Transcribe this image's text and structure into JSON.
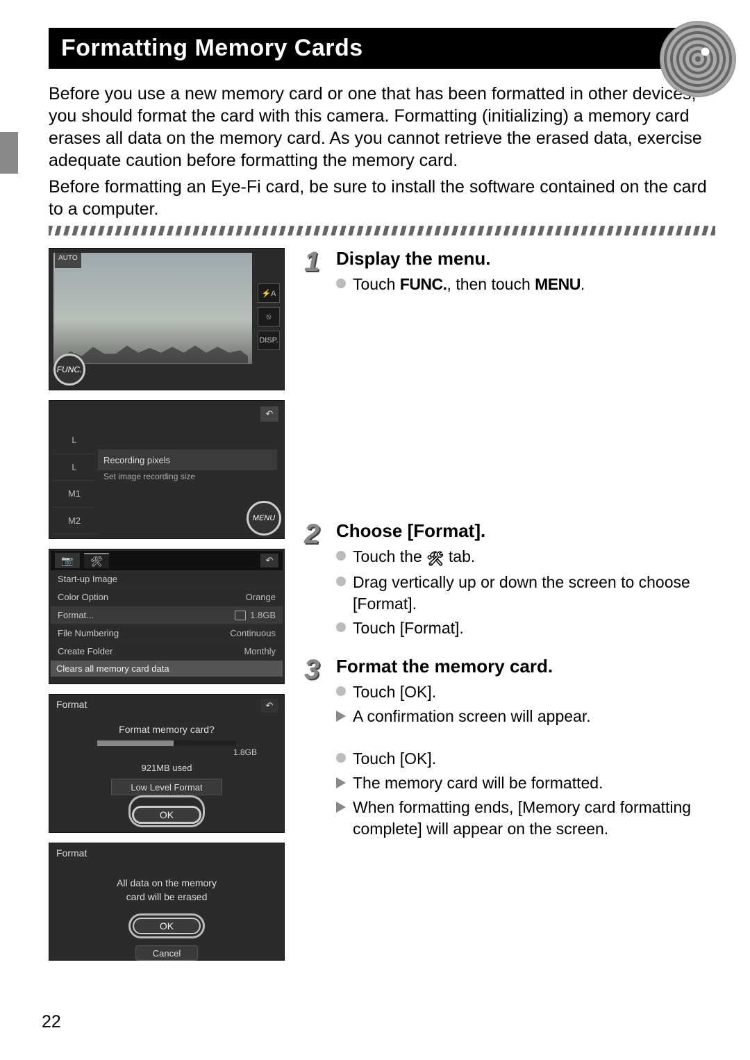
{
  "page_number": "22",
  "title": "Formatting Memory Cards",
  "intro1": "Before you use a new memory card or one that has been formatted in other devices, you should format the card with this camera. Formatting (initializing) a memory card erases all data on the memory card. As you cannot retrieve the erased data, exercise adequate caution before formatting the memory card.",
  "intro2": "Before formatting an Eye-Fi card, be sure to install the software contained on the card to a computer.",
  "screen1": {
    "top_mode": "AUTO",
    "func_label": "FUNC.",
    "right_icons": [
      "⚡A",
      "⦸",
      "DISP."
    ]
  },
  "screen2": {
    "back": "↶",
    "left_items": [
      "L",
      "L",
      "M1",
      "M2"
    ],
    "row_label": "Recording pixels",
    "sub_label": "Set image recording size",
    "menu_label": "MENU"
  },
  "screen3": {
    "tab_cam": "📷",
    "tab_tool": "🛠",
    "back": "↶",
    "rows": [
      {
        "l": "Start-up Image",
        "r": ""
      },
      {
        "l": "Color Option",
        "r": "Orange"
      },
      {
        "l": "Format...",
        "r": "1.8GB",
        "sel": true
      },
      {
        "l": "File Numbering",
        "r": "Continuous"
      },
      {
        "l": "Create Folder",
        "r": "Monthly"
      }
    ],
    "footer": "Clears all memory card data"
  },
  "screen4": {
    "title": "Format",
    "back": "↶",
    "question": "Format memory card?",
    "capacity": "1.8GB",
    "used": "921MB used",
    "low_level": "Low Level Format",
    "ok": "OK"
  },
  "screen5": {
    "title": "Format",
    "msg1": "All data on the memory",
    "msg2": "card will be erased",
    "ok": "OK",
    "cancel": "Cancel"
  },
  "steps": {
    "s1": {
      "num": "1",
      "title": "Display the menu.",
      "b1_a": "Touch ",
      "b1_func": "FUNC.",
      "b1_b": ", then touch ",
      "b1_menu": "MENU",
      "b1_c": "."
    },
    "s2": {
      "num": "2",
      "title": "Choose [Format].",
      "b1_a": "Touch the ",
      "b1_b": " tab.",
      "b2": "Drag vertically up or down the screen to choose [Format].",
      "b3": "Touch [Format]."
    },
    "s3": {
      "num": "3",
      "title": "Format the memory card.",
      "b1": "Touch [OK].",
      "b2": "A confirmation screen will appear.",
      "b3": "Touch [OK].",
      "b4": "The memory card will be formatted.",
      "b5": "When formatting ends, [Memory card formatting complete] will appear on the screen."
    }
  }
}
